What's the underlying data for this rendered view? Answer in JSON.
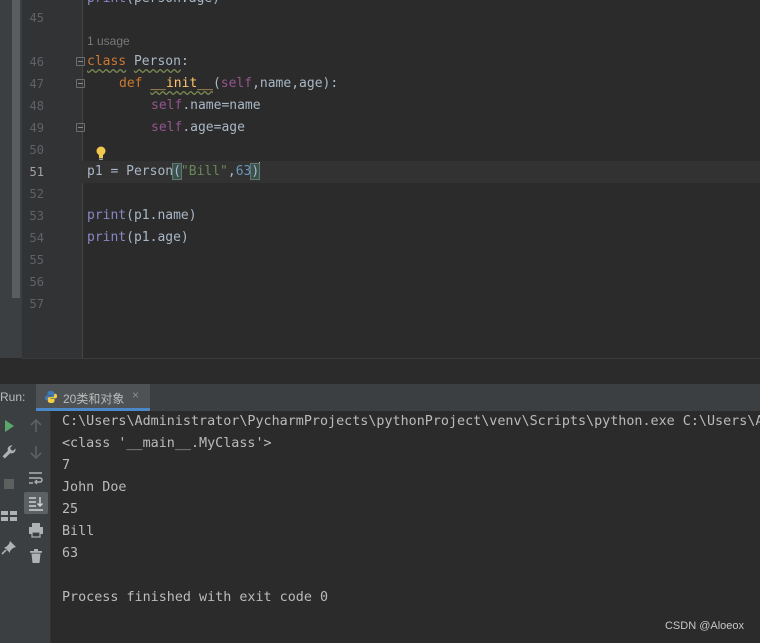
{
  "editor": {
    "line_numbers": [
      "45",
      "46",
      "47",
      "48",
      "49",
      "50",
      "51",
      "52",
      "53",
      "54",
      "55",
      "56",
      "57"
    ],
    "current_line": "51",
    "usage_hint": "1 usage",
    "code": {
      "l46_kw": "class",
      "l46_name": "Person",
      "l46_colon": ":",
      "l47_kw": "def",
      "l47_fn": "__init__",
      "l47_open": "(",
      "l47_self": "self",
      "l47_rest": ",name,age):",
      "l48_self": "self",
      "l48_rest": ".name=name",
      "l49_self": "self",
      "l49_rest": ".age=age",
      "l51_pre": "p1 = Person",
      "l51_open": "(",
      "l51_str": "\"Bill\"",
      "l51_comma": ",",
      "l51_num": "63",
      "l51_close": ")",
      "l53_print": "print",
      "l53_rest": "(p1.name)",
      "l54_print": "print",
      "l54_rest": "(p1.age)"
    }
  },
  "run": {
    "label": "Run:",
    "tab_label": "20类和对象",
    "tab_close": "×"
  },
  "console": {
    "lines": [
      "C:\\Users\\Administrator\\PycharmProjects\\pythonProject\\venv\\Scripts\\python.exe C:\\Users\\Ad",
      "<class '__main__.MyClass'>",
      "7",
      "John Doe",
      "25",
      "Bill",
      "63",
      "",
      "Process finished with exit code 0"
    ]
  },
  "watermark": "CSDN @Aloeox",
  "icons": [
    "run-icon",
    "wrench-icon",
    "stop-icon",
    "layout-icon",
    "pin-icon",
    "up-arrow-icon",
    "down-arrow-icon",
    "soft-wrap-icon",
    "scroll-to-end-icon",
    "print-icon",
    "trash-icon",
    "lightbulb-icon",
    "python-icon"
  ]
}
